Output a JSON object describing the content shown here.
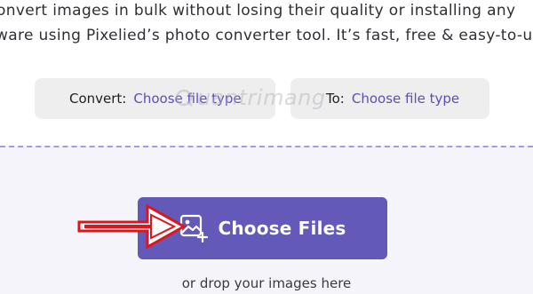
{
  "intro": {
    "line1": "onvert images in bulk without losing their quality or installing any",
    "line2": "ware using Pixelied’s photo converter tool. It’s fast, free & easy-to-u"
  },
  "converter": {
    "convert_label": "Convert:",
    "convert_value": "Choose file type",
    "to_label": "To:",
    "to_value": "Choose file type"
  },
  "upload": {
    "button_label": "Choose Files",
    "button_icon": "image-add-icon",
    "drop_hint": "or drop your images here"
  },
  "annotation": {
    "arrow_icon": "red-arrow-right-icon"
  },
  "watermark": {
    "text": "uantrimang",
    "mark_icon": "quantrimang-logo-icon"
  },
  "colors": {
    "accent": "#6359b8",
    "link": "#5a4fb8",
    "select_bg": "#eeeeee",
    "dropzone_bg": "#f5f4fb",
    "dashed_border": "#a79be0",
    "arrow": "#e0141a"
  }
}
